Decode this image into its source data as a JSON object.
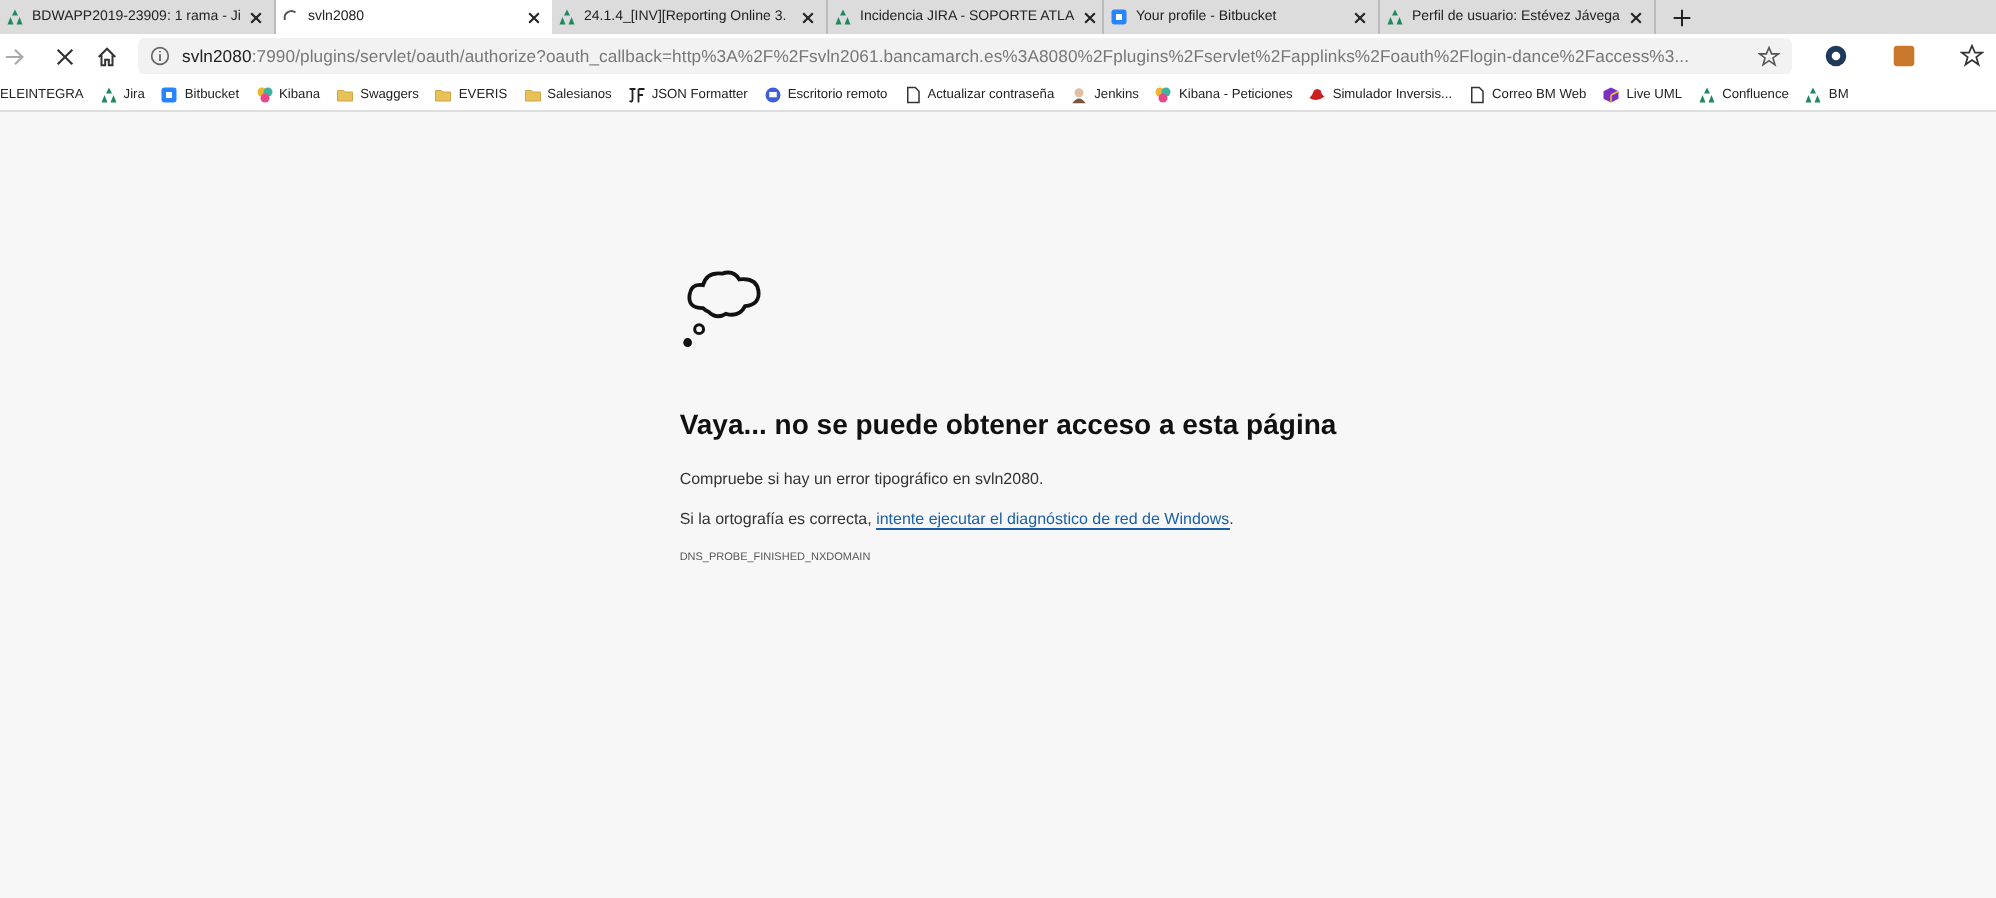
{
  "tabs": [
    {
      "kind": "atlassian",
      "title": "BDWAPP2019-23909: 1 rama - Ji",
      "selected": false
    },
    {
      "kind": "loading",
      "title": "svln2080",
      "selected": true
    },
    {
      "kind": "atlassian",
      "title": "24.1.4_[INV][Reporting Online 3.",
      "selected": false
    },
    {
      "kind": "atlassian",
      "title": "Incidencia JIRA - SOPORTE ATLA",
      "selected": false
    },
    {
      "kind": "bitbucket",
      "title": "Your profile - Bitbucket",
      "selected": false
    },
    {
      "kind": "atlassian",
      "title": "Perfil de usuario: Estévez Jávega",
      "selected": false
    }
  ],
  "address_bar": {
    "host": "svln2080",
    "rest": ":7990/plugins/servlet/oauth/authorize?oauth_callback=http%3A%2F%2Fsvln2061.bancamarch.es%3A8080%2Fplugins%2Fservlet%2Fapplinks%2Foauth%2Flogin-dance%2Faccess%3..."
  },
  "bookmarks": [
    {
      "kind": "none",
      "label": "ELEINTEGRA"
    },
    {
      "kind": "atlassian",
      "label": "Jira"
    },
    {
      "kind": "bitbucket",
      "label": "Bitbucket"
    },
    {
      "kind": "kibana",
      "label": "Kibana"
    },
    {
      "kind": "folder",
      "label": "Swaggers"
    },
    {
      "kind": "folder",
      "label": "EVERIS"
    },
    {
      "kind": "folder",
      "label": "Salesianos"
    },
    {
      "kind": "jf",
      "label": "JSON Formatter"
    },
    {
      "kind": "remote",
      "label": "Escritorio remoto"
    },
    {
      "kind": "page",
      "label": "Actualizar contraseña"
    },
    {
      "kind": "jenkins",
      "label": "Jenkins"
    },
    {
      "kind": "kibana",
      "label": "Kibana - Peticiones"
    },
    {
      "kind": "redhat",
      "label": "Simulador Inversis..."
    },
    {
      "kind": "page",
      "label": "Correo BM Web"
    },
    {
      "kind": "uml",
      "label": "Live UML"
    },
    {
      "kind": "atlassian",
      "label": "Confluence"
    },
    {
      "kind": "atlassian",
      "label": "BM"
    }
  ],
  "error_page": {
    "heading": "Vaya... no se puede obtener acceso a esta página",
    "line_1": "Compruebe si hay un error tipográfico en svln2080.",
    "line_2_prefix": "Si la ortografía es correcta,",
    "link": "intente ejecutar el diagnóstico de red de Windows",
    "line_2_suffix": ".",
    "code": "DNS_PROBE_FINISHED_NXDOMAIN"
  }
}
